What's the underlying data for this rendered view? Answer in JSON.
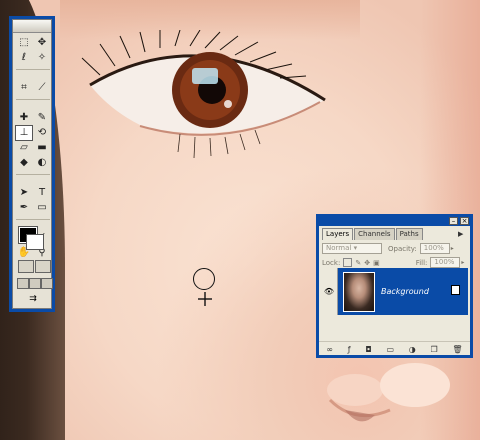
{
  "app": "Adobe Photoshop",
  "canvas": {
    "description_icon": "photo-of-face"
  },
  "toolbox": {
    "tools": [
      {
        "icon": "rect-marquee-icon",
        "glyph": "⬚"
      },
      {
        "icon": "move-icon",
        "glyph": "✥"
      },
      {
        "icon": "lasso-icon",
        "glyph": "ℓ"
      },
      {
        "icon": "magic-wand-icon",
        "glyph": "✧"
      },
      {
        "icon": "crop-icon",
        "glyph": "⌗"
      },
      {
        "icon": "slice-icon",
        "glyph": "⟋"
      },
      {
        "icon": "healing-brush-icon",
        "glyph": "✚"
      },
      {
        "icon": "brush-icon",
        "glyph": "✎"
      },
      {
        "icon": "clone-stamp-icon",
        "glyph": "⊥",
        "selected": true
      },
      {
        "icon": "history-brush-icon",
        "glyph": "⟲"
      },
      {
        "icon": "eraser-icon",
        "glyph": "▱"
      },
      {
        "icon": "gradient-icon",
        "glyph": "▬"
      },
      {
        "icon": "blur-icon",
        "glyph": "◆"
      },
      {
        "icon": "dodge-icon",
        "glyph": "◐"
      },
      {
        "icon": "path-select-icon",
        "glyph": "➤"
      },
      {
        "icon": "type-icon",
        "glyph": "T"
      },
      {
        "icon": "pen-icon",
        "glyph": "✒"
      },
      {
        "icon": "shape-icon",
        "glyph": "▭"
      },
      {
        "icon": "notes-icon",
        "glyph": "▤"
      },
      {
        "icon": "eyedropper-icon",
        "glyph": "⁄"
      },
      {
        "icon": "hand-icon",
        "glyph": "✋"
      },
      {
        "icon": "zoom-icon",
        "glyph": "⚲"
      }
    ],
    "foreground_color": "#000000",
    "background_color": "#ffffff"
  },
  "layers_panel": {
    "tabs": [
      {
        "label": "Layers",
        "active": true
      },
      {
        "label": "Channels",
        "active": false
      },
      {
        "label": "Paths",
        "active": false
      }
    ],
    "blend_mode": "Normal",
    "opacity_label": "Opacity:",
    "opacity_value": "100%",
    "lock_label": "Lock:",
    "fill_label": "Fill:",
    "fill_value": "100%",
    "layers": [
      {
        "name": "Background",
        "visible": true,
        "locked": true
      }
    ],
    "bottom_icons": [
      "link-icon",
      "layer-style-icon",
      "mask-icon",
      "new-set-icon",
      "adjustment-icon",
      "new-layer-icon",
      "trash-icon"
    ]
  },
  "accent_color": "#0a4ba7"
}
